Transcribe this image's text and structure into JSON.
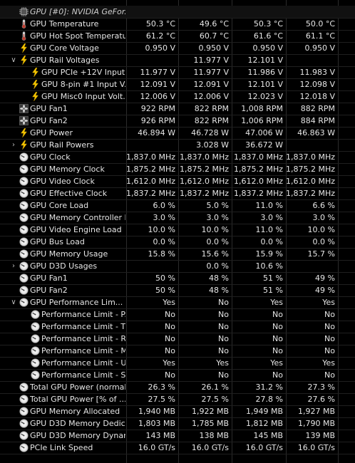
{
  "rows": [
    {
      "depth": 0,
      "expand": "",
      "icon": "chip-icon",
      "label": "GPU [#0]: NVIDIA GeFor...",
      "values": [
        "",
        "",
        "",
        ""
      ],
      "header": true
    },
    {
      "depth": 0,
      "expand": "",
      "icon": "thermometer-icon",
      "label": "GPU Temperature",
      "values": [
        "50.3 °C",
        "49.6 °C",
        "50.3 °C",
        "50.0 °C"
      ]
    },
    {
      "depth": 0,
      "expand": "",
      "icon": "thermometer-icon",
      "label": "GPU Hot Spot Temperature",
      "values": [
        "61.2 °C",
        "60.7 °C",
        "61.6 °C",
        "61.1 °C"
      ]
    },
    {
      "depth": 0,
      "expand": "",
      "icon": "lightning-icon",
      "label": "GPU Core Voltage",
      "values": [
        "0.950 V",
        "0.950 V",
        "0.950 V",
        "0.950 V"
      ]
    },
    {
      "depth": 0,
      "expand": "v",
      "icon": "lightning-icon",
      "label": "GPU Rail Voltages",
      "values": [
        "",
        "11.977 V",
        "12.101 V",
        ""
      ]
    },
    {
      "depth": 1,
      "expand": "",
      "icon": "lightning-icon",
      "label": "GPU PCIe +12V Input...",
      "values": [
        "11.977 V",
        "11.977 V",
        "11.986 V",
        "11.983 V"
      ]
    },
    {
      "depth": 1,
      "expand": "",
      "icon": "lightning-icon",
      "label": "GPU 8-pin #1 Input V...",
      "values": [
        "12.091 V",
        "12.091 V",
        "12.101 V",
        "12.098 V"
      ]
    },
    {
      "depth": 1,
      "expand": "",
      "icon": "lightning-icon",
      "label": "GPU Misc0 Input Volt...",
      "values": [
        "12.006 V",
        "12.006 V",
        "12.023 V",
        "12.018 V"
      ]
    },
    {
      "depth": 0,
      "expand": "",
      "icon": "fan-icon",
      "label": "GPU Fan1",
      "values": [
        "922 RPM",
        "822 RPM",
        "1,008 RPM",
        "882 RPM"
      ]
    },
    {
      "depth": 0,
      "expand": "",
      "icon": "fan-icon",
      "label": "GPU Fan2",
      "values": [
        "926 RPM",
        "822 RPM",
        "1,006 RPM",
        "884 RPM"
      ]
    },
    {
      "depth": 0,
      "expand": "",
      "icon": "lightning-icon",
      "label": "GPU Power",
      "values": [
        "46.894 W",
        "46.728 W",
        "47.006 W",
        "46.863 W"
      ]
    },
    {
      "depth": 0,
      "expand": ">",
      "icon": "lightning-icon",
      "label": "GPU Rail Powers",
      "values": [
        "",
        "3.028 W",
        "36.672 W",
        ""
      ]
    },
    {
      "depth": 0,
      "expand": "",
      "icon": "clock-icon",
      "label": "GPU Clock",
      "values": [
        "1,837.0 MHz",
        "1,837.0 MHz",
        "1,837.0 MHz",
        "1,837.0 MHz"
      ]
    },
    {
      "depth": 0,
      "expand": "",
      "icon": "clock-icon",
      "label": "GPU Memory Clock",
      "values": [
        "1,875.2 MHz",
        "1,875.2 MHz",
        "1,875.2 MHz",
        "1,875.2 MHz"
      ]
    },
    {
      "depth": 0,
      "expand": "",
      "icon": "clock-icon",
      "label": "GPU Video Clock",
      "values": [
        "1,612.0 MHz",
        "1,612.0 MHz",
        "1,612.0 MHz",
        "1,612.0 MHz"
      ]
    },
    {
      "depth": 0,
      "expand": "",
      "icon": "clock-icon",
      "label": "GPU Effective Clock",
      "values": [
        "1,837.2 MHz",
        "1,837.2 MHz",
        "1,837.2 MHz",
        "1,837.2 MHz"
      ]
    },
    {
      "depth": 0,
      "expand": "",
      "icon": "clock-icon",
      "label": "GPU Core Load",
      "values": [
        "6.0 %",
        "5.0 %",
        "11.0 %",
        "6.6 %"
      ]
    },
    {
      "depth": 0,
      "expand": "",
      "icon": "clock-icon",
      "label": "GPU Memory Controller L...",
      "values": [
        "3.0 %",
        "3.0 %",
        "3.0 %",
        "3.0 %"
      ]
    },
    {
      "depth": 0,
      "expand": "",
      "icon": "clock-icon",
      "label": "GPU Video Engine Load",
      "values": [
        "10.0 %",
        "10.0 %",
        "11.0 %",
        "10.0 %"
      ]
    },
    {
      "depth": 0,
      "expand": "",
      "icon": "clock-icon",
      "label": "GPU Bus Load",
      "values": [
        "0.0 %",
        "0.0 %",
        "0.0 %",
        "0.0 %"
      ]
    },
    {
      "depth": 0,
      "expand": "",
      "icon": "clock-icon",
      "label": "GPU Memory Usage",
      "values": [
        "15.8 %",
        "15.6 %",
        "15.9 %",
        "15.7 %"
      ]
    },
    {
      "depth": 0,
      "expand": ">",
      "icon": "clock-icon",
      "label": "GPU D3D Usages",
      "values": [
        "",
        "0.0 %",
        "10.6 %",
        ""
      ]
    },
    {
      "depth": 0,
      "expand": "",
      "icon": "clock-icon",
      "label": "GPU Fan1",
      "values": [
        "50 %",
        "48 %",
        "51 %",
        "49 %"
      ]
    },
    {
      "depth": 0,
      "expand": "",
      "icon": "clock-icon",
      "label": "GPU Fan2",
      "values": [
        "50 %",
        "48 %",
        "51 %",
        "49 %"
      ]
    },
    {
      "depth": 0,
      "expand": "v",
      "icon": "clock-icon",
      "label": "GPU Performance Lim...",
      "values": [
        "Yes",
        "No",
        "Yes",
        "Yes"
      ]
    },
    {
      "depth": 1,
      "expand": "",
      "icon": "clock-icon",
      "label": "Performance Limit - P...",
      "values": [
        "No",
        "No",
        "No",
        "No"
      ]
    },
    {
      "depth": 1,
      "expand": "",
      "icon": "clock-icon",
      "label": "Performance Limit - T...",
      "values": [
        "No",
        "No",
        "No",
        "No"
      ]
    },
    {
      "depth": 1,
      "expand": "",
      "icon": "clock-icon",
      "label": "Performance Limit - R...",
      "values": [
        "No",
        "No",
        "No",
        "No"
      ]
    },
    {
      "depth": 1,
      "expand": "",
      "icon": "clock-icon",
      "label": "Performance Limit - M...",
      "values": [
        "No",
        "No",
        "No",
        "No"
      ]
    },
    {
      "depth": 1,
      "expand": "",
      "icon": "clock-icon",
      "label": "Performance Limit - U...",
      "values": [
        "Yes",
        "Yes",
        "Yes",
        "Yes"
      ]
    },
    {
      "depth": 1,
      "expand": "",
      "icon": "clock-icon",
      "label": "Performance Limit - S...",
      "values": [
        "No",
        "No",
        "No",
        "No"
      ]
    },
    {
      "depth": 0,
      "expand": "",
      "icon": "clock-icon",
      "label": "Total GPU Power (normal...",
      "values": [
        "26.3 %",
        "26.1 %",
        "31.2 %",
        "27.3 %"
      ]
    },
    {
      "depth": 0,
      "expand": "",
      "icon": "clock-icon",
      "label": "Total GPU Power [% of ...",
      "values": [
        "27.5 %",
        "27.5 %",
        "27.8 %",
        "27.6 %"
      ]
    },
    {
      "depth": 0,
      "expand": "",
      "icon": "clock-icon",
      "label": "GPU Memory Allocated",
      "values": [
        "1,940 MB",
        "1,922 MB",
        "1,949 MB",
        "1,927 MB"
      ]
    },
    {
      "depth": 0,
      "expand": "",
      "icon": "clock-icon",
      "label": "GPU D3D Memory Dedica...",
      "values": [
        "1,803 MB",
        "1,785 MB",
        "1,812 MB",
        "1,790 MB"
      ]
    },
    {
      "depth": 0,
      "expand": "",
      "icon": "clock-icon",
      "label": "GPU D3D Memory Dynamic",
      "values": [
        "143 MB",
        "138 MB",
        "145 MB",
        "139 MB"
      ]
    },
    {
      "depth": 0,
      "expand": "",
      "icon": "clock-icon",
      "label": "PCIe Link Speed",
      "values": [
        "16.0 GT/s",
        "16.0 GT/s",
        "16.0 GT/s",
        "16.0 GT/s"
      ]
    }
  ],
  "colors": {
    "background": "#000000",
    "text": "#e6e6e6",
    "voltage_icon": "#f5c400",
    "thermometer": "#c8c8c8"
  }
}
